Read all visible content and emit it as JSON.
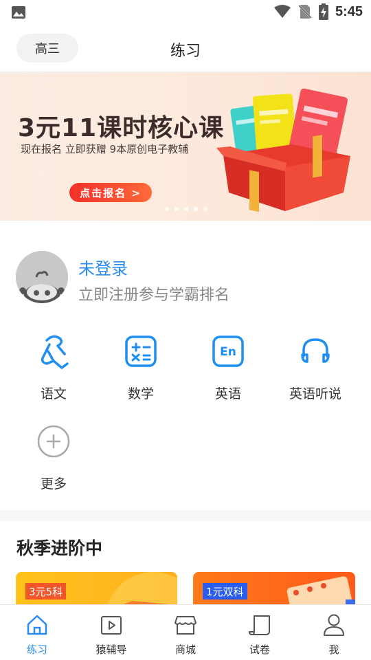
{
  "status_bar": {
    "time": "5:45"
  },
  "header": {
    "grade": "高三",
    "title": "练习"
  },
  "banner": {
    "headline": "3元11课时核心课",
    "subline": "现在报名 立即获赠 9本原创电子教辅",
    "cta": "点击报名 >",
    "active_slide": 4,
    "slide_count": 5
  },
  "profile": {
    "title": "未登录",
    "subtitle": "立即注册参与学霸排名"
  },
  "subjects": [
    {
      "label": "语文",
      "icon": "chinese-icon"
    },
    {
      "label": "数学",
      "icon": "math-icon"
    },
    {
      "label": "英语",
      "icon": "english-icon",
      "icon_text": "En"
    },
    {
      "label": "英语听说",
      "icon": "headphones-icon"
    },
    {
      "label": "更多",
      "icon": "add-circle-icon"
    }
  ],
  "section": {
    "title": "秋季进阶中"
  },
  "cards": [
    {
      "tag": "3元5科"
    },
    {
      "tag": "1元双科"
    }
  ],
  "tabs": [
    {
      "label": "练习",
      "icon": "home-icon",
      "active": true
    },
    {
      "label": "猿辅导",
      "icon": "play-icon",
      "active": false
    },
    {
      "label": "商城",
      "icon": "store-icon",
      "active": false
    },
    {
      "label": "试卷",
      "icon": "paper-icon",
      "active": false
    },
    {
      "label": "我",
      "icon": "profile-icon",
      "active": false
    }
  ],
  "colors": {
    "accent": "#2a8cf0",
    "cta": "#f5302a",
    "subtitle_text": "#888888"
  }
}
